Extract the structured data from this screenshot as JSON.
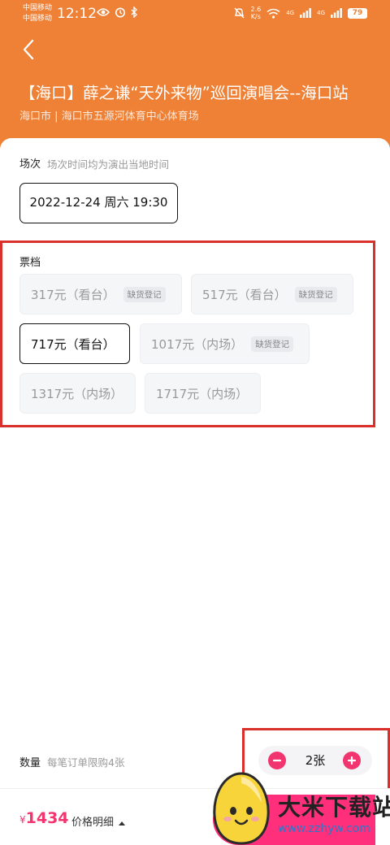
{
  "status_bar": {
    "carrier_1": "中国移动",
    "carrier_2": "中国移动",
    "time": "12:12",
    "net_speed_value": "2.6",
    "net_speed_unit": "K/s",
    "signal_1_label": "4G",
    "signal_2_label": "4G",
    "battery": "79"
  },
  "header": {
    "back_icon": "chevron-left-icon",
    "title": "【海口】薛之谦“天外来物”巡回演唱会--海口站",
    "venue": "海口市 | 海口市五源河体育中心体育场",
    "background_color": "#ee8136"
  },
  "session": {
    "label": "场次",
    "hint": "场次时间均为演出当地时间",
    "selected": "2022-12-24 周六 19:30"
  },
  "tiers": {
    "label": "票档",
    "items": [
      {
        "price": "317元（看台）",
        "tag": "缺货登记",
        "state": "sold_out"
      },
      {
        "price": "517元（看台）",
        "tag": "缺货登记",
        "state": "sold_out"
      },
      {
        "price": "717元（看台）",
        "tag": "",
        "state": "selected"
      },
      {
        "price": "1017元（内场）",
        "tag": "缺货登记",
        "state": "sold_out"
      },
      {
        "price": "1317元（内场）",
        "tag": "",
        "state": "available"
      },
      {
        "price": "1717元（内场）",
        "tag": "",
        "state": "available"
      }
    ]
  },
  "quantity": {
    "label": "数量",
    "hint": "每笔订单限购4张",
    "value": "2张",
    "accent_color": "#f2356e"
  },
  "footer": {
    "currency": "¥",
    "total": "1434",
    "detail_label": "价格明细",
    "detail_icon": "caret-up-icon",
    "button_color": "#ff2f7b"
  },
  "watermark": {
    "text": "大米下载站",
    "url": "www.zzhyw.com"
  },
  "annotation_color": "#d9302c"
}
